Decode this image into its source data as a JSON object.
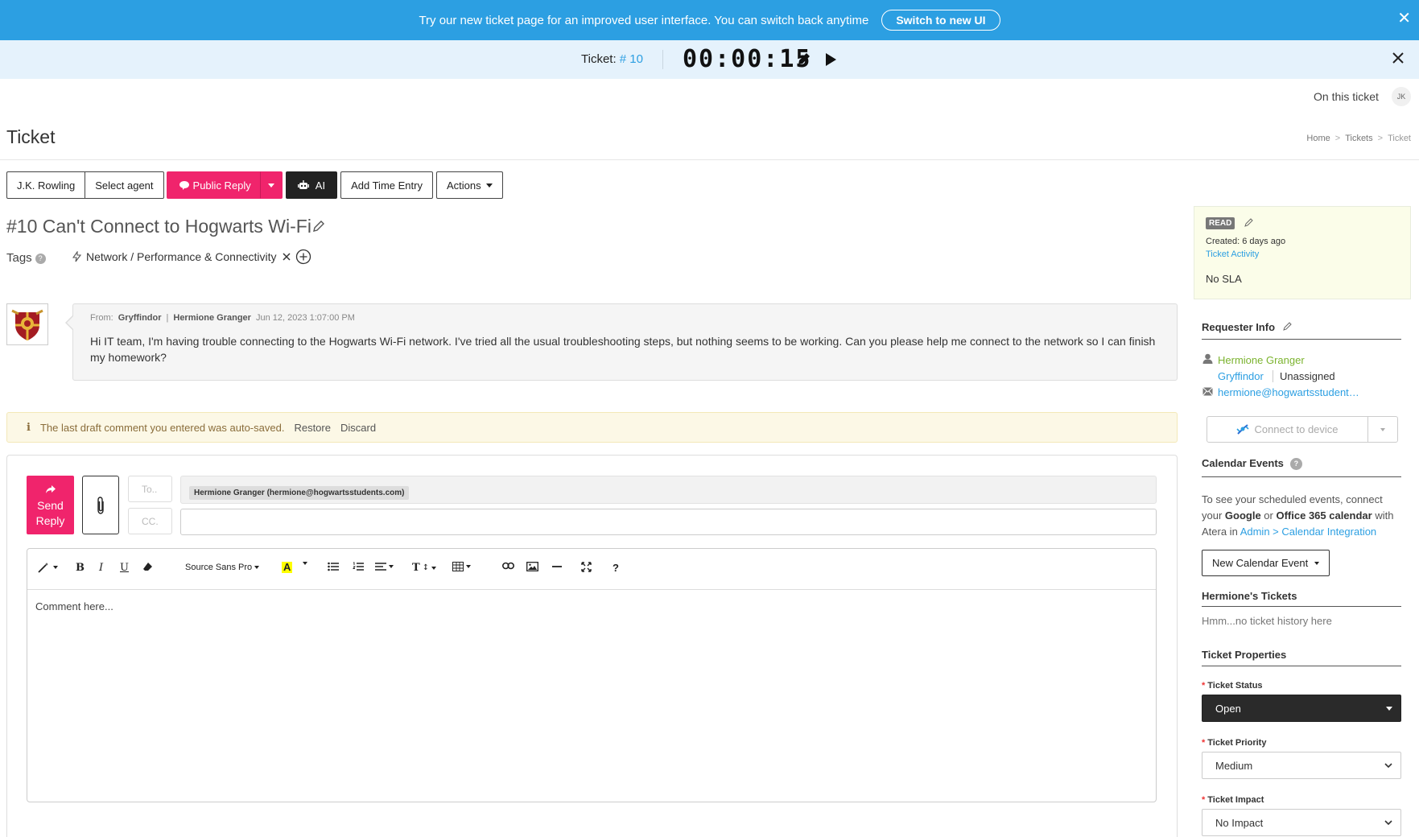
{
  "banner": {
    "text": "Try our new ticket page for an improved user interface. You can switch back anytime",
    "button": "Switch to new UI",
    "close": "✕"
  },
  "timerbar": {
    "ticket_label": "Ticket:",
    "ticket_number": "# 10",
    "timer": "00:00:15"
  },
  "header": {
    "on_this_ticket": "On this ticket",
    "avatar_initials": "JK",
    "page_title": "Ticket",
    "breadcrumb": [
      "Home",
      "Tickets",
      "Ticket"
    ]
  },
  "toolbar": {
    "requester": "J.K. Rowling",
    "agent": "Select agent",
    "public_reply": "Public Reply",
    "ai": "AI",
    "add_time": "Add Time Entry",
    "actions": "Actions"
  },
  "ticket": {
    "heading": "#10 Can't Connect to Hogwarts Wi-Fi",
    "tags_label": "Tags",
    "tag": "Network / Performance & Connectivity"
  },
  "message": {
    "from_label": "From:",
    "org": "Gryffindor",
    "separator": "|",
    "author": "Hermione Granger",
    "date": "Jun 12, 2023 1:07:00 PM",
    "body": "Hi IT team, I'm having trouble connecting to the Hogwarts Wi-Fi network. I've tried all the usual troubleshooting steps, but nothing seems to be working. Can you please help me connect to the network so I can finish my homework?"
  },
  "draft": {
    "notice": "The last draft comment you entered was auto-saved.",
    "restore": "Restore",
    "discard": "Discard"
  },
  "reply": {
    "send_line1": "Send",
    "send_line2": "Reply",
    "to_label": "To..",
    "cc_label": "CC.",
    "to_chip": "Hermione Granger (hermione@hogwartsstudents.com)",
    "font": "Source Sans Pro",
    "placeholder": "Comment here..."
  },
  "sidebar": {
    "read_badge": "READ",
    "created": "Created: 6 days ago",
    "activity": "Ticket Activity",
    "sla": "No SLA",
    "requester_title": "Requester Info",
    "requester_name": "Hermione Granger",
    "requester_org": "Gryffindor",
    "requester_assign": "Unassigned",
    "requester_email": "hermione@hogwartsstudents.com",
    "connect": "Connect to device",
    "calendar_title": "Calendar Events",
    "cal_text1": "To see your scheduled events, connect your ",
    "cal_google": "Google",
    "cal_or": " or ",
    "cal_office": "Office 365 calendar",
    "cal_text2": " with Atera in ",
    "cal_link": "Admin > Calendar Integration",
    "new_cal": "New Calendar Event",
    "tickets_title": "Hermione's Tickets",
    "no_history": "Hmm...no ticket history here",
    "props_title": "Ticket Properties",
    "status_label": "Ticket Status",
    "status_value": "Open",
    "priority_label": "Ticket Priority",
    "priority_value": "Medium",
    "impact_label": "Ticket Impact",
    "impact_value": "No Impact"
  }
}
